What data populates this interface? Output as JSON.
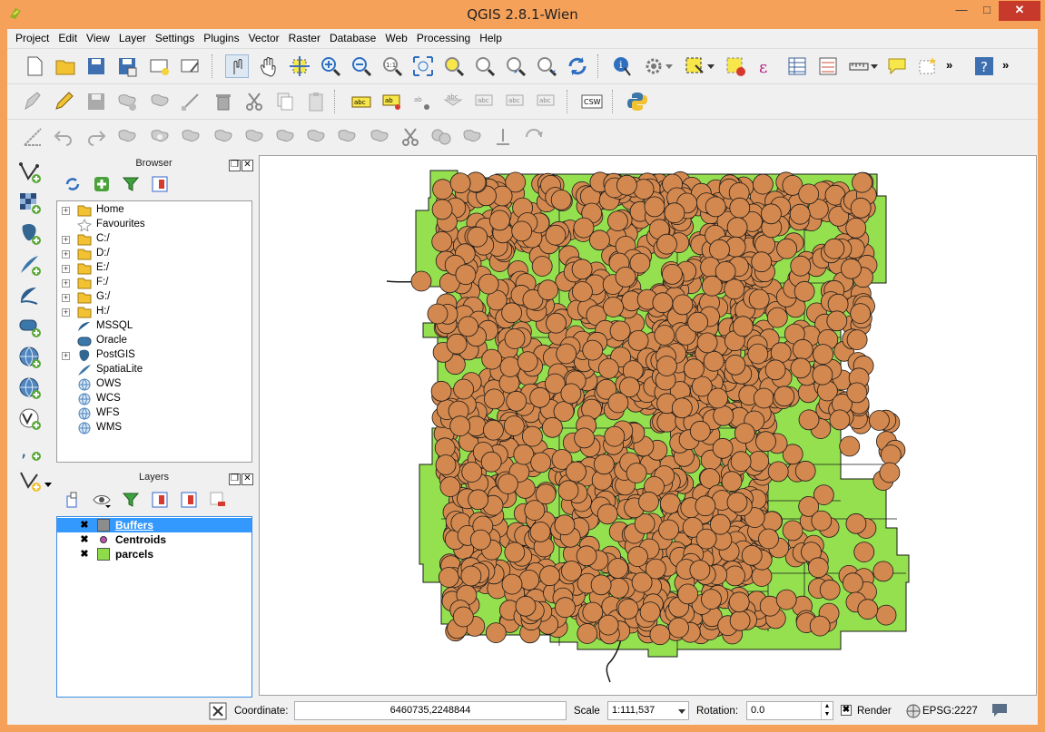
{
  "window": {
    "title": "QGIS 2.8.1-Wien"
  },
  "menu": [
    "Project",
    "Edit",
    "View",
    "Layer",
    "Settings",
    "Plugins",
    "Vector",
    "Raster",
    "Database",
    "Web",
    "Processing",
    "Help"
  ],
  "browser": {
    "title": "Browser",
    "items": [
      {
        "label": "Home",
        "icon": "folder-icon",
        "expandable": true
      },
      {
        "label": "Favourites",
        "icon": "star-icon",
        "expandable": false
      },
      {
        "label": "C:/",
        "icon": "folder-icon",
        "expandable": true
      },
      {
        "label": "D:/",
        "icon": "folder-icon",
        "expandable": true
      },
      {
        "label": "E:/",
        "icon": "folder-icon",
        "expandable": true
      },
      {
        "label": "F:/",
        "icon": "folder-icon",
        "expandable": true
      },
      {
        "label": "G:/",
        "icon": "folder-icon",
        "expandable": true
      },
      {
        "label": "H:/",
        "icon": "folder-icon",
        "expandable": true
      },
      {
        "label": "MSSQL",
        "icon": "mssql-icon",
        "expandable": false
      },
      {
        "label": "Oracle",
        "icon": "oracle-icon",
        "expandable": false
      },
      {
        "label": "PostGIS",
        "icon": "postgis-icon",
        "expandable": true
      },
      {
        "label": "SpatiaLite",
        "icon": "spatialite-icon",
        "expandable": false
      },
      {
        "label": "OWS",
        "icon": "globe-icon",
        "expandable": false
      },
      {
        "label": "WCS",
        "icon": "globe-icon",
        "expandable": false
      },
      {
        "label": "WFS",
        "icon": "globe-icon",
        "expandable": false
      },
      {
        "label": "WMS",
        "icon": "globe-icon",
        "expandable": false
      }
    ]
  },
  "layers": {
    "title": "Layers",
    "items": [
      {
        "name": "Buffers",
        "checked": "✖",
        "symbol_color": "#8c8c8c",
        "selected": true
      },
      {
        "name": "Centroids",
        "checked": "✖",
        "symbol_color": "#c050b0",
        "selected": false
      },
      {
        "name": "parcels",
        "checked": "✖",
        "symbol_color": "#8fdc4a",
        "selected": false
      }
    ]
  },
  "map": {
    "parcel_color": "#95e04f",
    "buffer_color": "#d2884e",
    "outline_color": "#1a1a1a"
  },
  "status": {
    "coordinate_label": "Coordinate:",
    "coordinate_value": "6460735,2248844",
    "scale_label": "Scale",
    "scale_value": "1:111,537",
    "rotation_label": "Rotation:",
    "rotation_value": "0.0",
    "render_label": "Render",
    "render_checked": "✖",
    "crs_label": "EPSG:2227"
  }
}
